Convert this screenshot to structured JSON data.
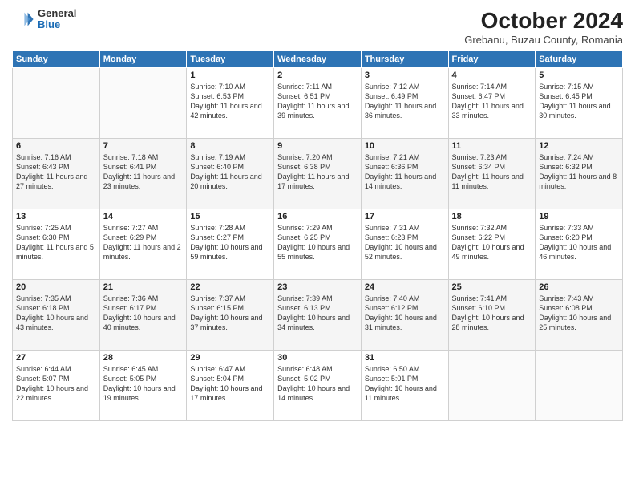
{
  "header": {
    "logo_general": "General",
    "logo_blue": "Blue",
    "month_title": "October 2024",
    "location": "Grebanu, Buzau County, Romania"
  },
  "days_of_week": [
    "Sunday",
    "Monday",
    "Tuesday",
    "Wednesday",
    "Thursday",
    "Friday",
    "Saturday"
  ],
  "weeks": [
    [
      {
        "day": "",
        "info": ""
      },
      {
        "day": "",
        "info": ""
      },
      {
        "day": "1",
        "info": "Sunrise: 7:10 AM\nSunset: 6:53 PM\nDaylight: 11 hours and 42 minutes."
      },
      {
        "day": "2",
        "info": "Sunrise: 7:11 AM\nSunset: 6:51 PM\nDaylight: 11 hours and 39 minutes."
      },
      {
        "day": "3",
        "info": "Sunrise: 7:12 AM\nSunset: 6:49 PM\nDaylight: 11 hours and 36 minutes."
      },
      {
        "day": "4",
        "info": "Sunrise: 7:14 AM\nSunset: 6:47 PM\nDaylight: 11 hours and 33 minutes."
      },
      {
        "day": "5",
        "info": "Sunrise: 7:15 AM\nSunset: 6:45 PM\nDaylight: 11 hours and 30 minutes."
      }
    ],
    [
      {
        "day": "6",
        "info": "Sunrise: 7:16 AM\nSunset: 6:43 PM\nDaylight: 11 hours and 27 minutes."
      },
      {
        "day": "7",
        "info": "Sunrise: 7:18 AM\nSunset: 6:41 PM\nDaylight: 11 hours and 23 minutes."
      },
      {
        "day": "8",
        "info": "Sunrise: 7:19 AM\nSunset: 6:40 PM\nDaylight: 11 hours and 20 minutes."
      },
      {
        "day": "9",
        "info": "Sunrise: 7:20 AM\nSunset: 6:38 PM\nDaylight: 11 hours and 17 minutes."
      },
      {
        "day": "10",
        "info": "Sunrise: 7:21 AM\nSunset: 6:36 PM\nDaylight: 11 hours and 14 minutes."
      },
      {
        "day": "11",
        "info": "Sunrise: 7:23 AM\nSunset: 6:34 PM\nDaylight: 11 hours and 11 minutes."
      },
      {
        "day": "12",
        "info": "Sunrise: 7:24 AM\nSunset: 6:32 PM\nDaylight: 11 hours and 8 minutes."
      }
    ],
    [
      {
        "day": "13",
        "info": "Sunrise: 7:25 AM\nSunset: 6:30 PM\nDaylight: 11 hours and 5 minutes."
      },
      {
        "day": "14",
        "info": "Sunrise: 7:27 AM\nSunset: 6:29 PM\nDaylight: 11 hours and 2 minutes."
      },
      {
        "day": "15",
        "info": "Sunrise: 7:28 AM\nSunset: 6:27 PM\nDaylight: 10 hours and 59 minutes."
      },
      {
        "day": "16",
        "info": "Sunrise: 7:29 AM\nSunset: 6:25 PM\nDaylight: 10 hours and 55 minutes."
      },
      {
        "day": "17",
        "info": "Sunrise: 7:31 AM\nSunset: 6:23 PM\nDaylight: 10 hours and 52 minutes."
      },
      {
        "day": "18",
        "info": "Sunrise: 7:32 AM\nSunset: 6:22 PM\nDaylight: 10 hours and 49 minutes."
      },
      {
        "day": "19",
        "info": "Sunrise: 7:33 AM\nSunset: 6:20 PM\nDaylight: 10 hours and 46 minutes."
      }
    ],
    [
      {
        "day": "20",
        "info": "Sunrise: 7:35 AM\nSunset: 6:18 PM\nDaylight: 10 hours and 43 minutes."
      },
      {
        "day": "21",
        "info": "Sunrise: 7:36 AM\nSunset: 6:17 PM\nDaylight: 10 hours and 40 minutes."
      },
      {
        "day": "22",
        "info": "Sunrise: 7:37 AM\nSunset: 6:15 PM\nDaylight: 10 hours and 37 minutes."
      },
      {
        "day": "23",
        "info": "Sunrise: 7:39 AM\nSunset: 6:13 PM\nDaylight: 10 hours and 34 minutes."
      },
      {
        "day": "24",
        "info": "Sunrise: 7:40 AM\nSunset: 6:12 PM\nDaylight: 10 hours and 31 minutes."
      },
      {
        "day": "25",
        "info": "Sunrise: 7:41 AM\nSunset: 6:10 PM\nDaylight: 10 hours and 28 minutes."
      },
      {
        "day": "26",
        "info": "Sunrise: 7:43 AM\nSunset: 6:08 PM\nDaylight: 10 hours and 25 minutes."
      }
    ],
    [
      {
        "day": "27",
        "info": "Sunrise: 6:44 AM\nSunset: 5:07 PM\nDaylight: 10 hours and 22 minutes."
      },
      {
        "day": "28",
        "info": "Sunrise: 6:45 AM\nSunset: 5:05 PM\nDaylight: 10 hours and 19 minutes."
      },
      {
        "day": "29",
        "info": "Sunrise: 6:47 AM\nSunset: 5:04 PM\nDaylight: 10 hours and 17 minutes."
      },
      {
        "day": "30",
        "info": "Sunrise: 6:48 AM\nSunset: 5:02 PM\nDaylight: 10 hours and 14 minutes."
      },
      {
        "day": "31",
        "info": "Sunrise: 6:50 AM\nSunset: 5:01 PM\nDaylight: 10 hours and 11 minutes."
      },
      {
        "day": "",
        "info": ""
      },
      {
        "day": "",
        "info": ""
      }
    ]
  ]
}
